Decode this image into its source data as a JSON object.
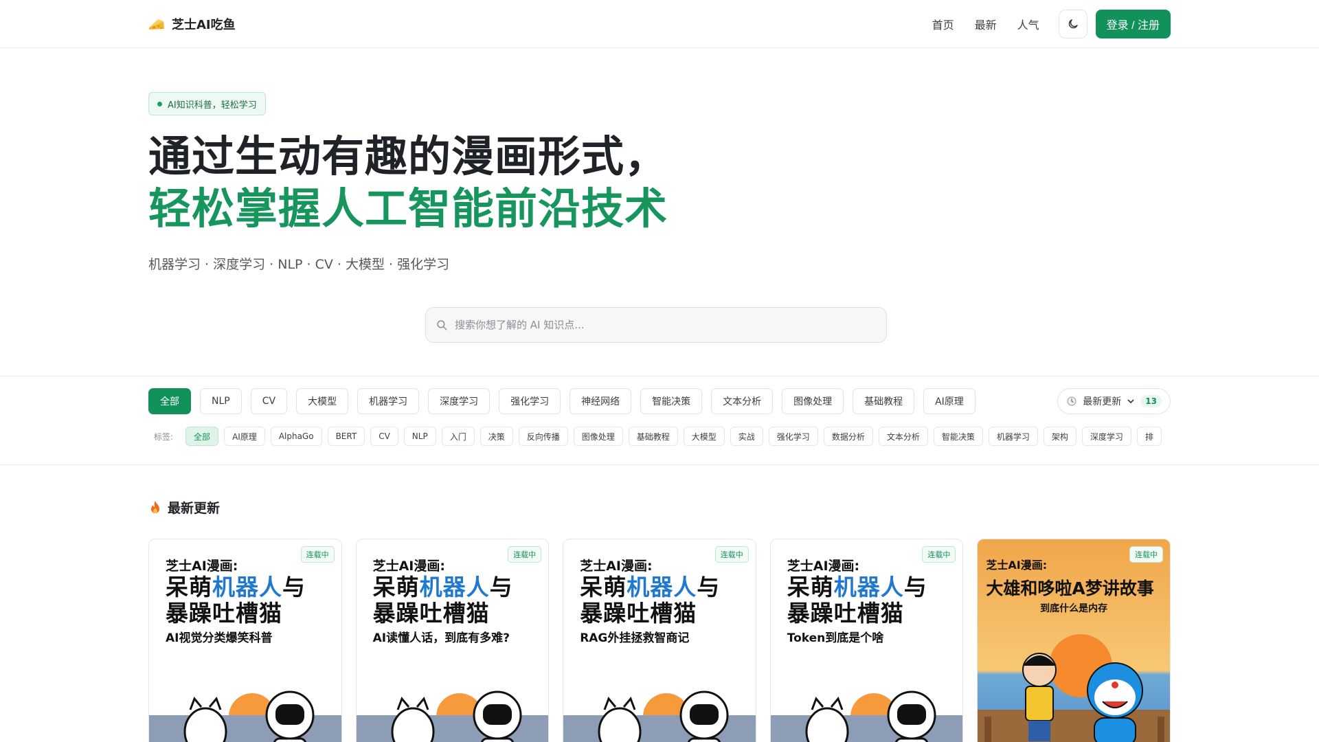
{
  "brand": {
    "name": "芝士AI吃鱼",
    "logo_icon": "cheese-icon"
  },
  "nav": {
    "items": [
      "首页",
      "最新",
      "人气"
    ],
    "login_label": "登录 / 注册"
  },
  "hero": {
    "badge": "AI知识科普，轻松学习",
    "headline_line1": "通过生动有趣的漫画形式，",
    "headline_line2": "轻松掌握人工智能前沿技术",
    "subtitle": "机器学习 · 深度学习 · NLP · CV · 大模型 · 强化学习",
    "search_placeholder": "搜索你想了解的 AI 知识点..."
  },
  "filters": {
    "categories": [
      "全部",
      "NLP",
      "CV",
      "大模型",
      "机器学习",
      "深度学习",
      "强化学习",
      "神经网络",
      "智能决策",
      "文本分析",
      "图像处理",
      "基础教程",
      "AI原理"
    ],
    "active_category": "全部",
    "sort_label": "最新更新",
    "count": "13",
    "tag_label": "标签:",
    "tags": [
      "全部",
      "AI原理",
      "AlphaGo",
      "BERT",
      "CV",
      "NLP",
      "入门",
      "决策",
      "反向传播",
      "图像处理",
      "基础教程",
      "大模型",
      "实战",
      "强化学习",
      "数据分析",
      "文本分析",
      "智能决策",
      "机器学习",
      "架构",
      "深度学习",
      "排"
    ]
  },
  "section": {
    "title": "最新更新",
    "icon": "fire-icon"
  },
  "cards": [
    {
      "status": "连载中",
      "series": "芝士AI漫画:",
      "title_a": "呆萌",
      "title_b": "机器人",
      "title_c": "与",
      "title_d": "暴躁吐槽猫",
      "subtitle": "AI视觉分类爆笑科普"
    },
    {
      "status": "连载中",
      "series": "芝士AI漫画:",
      "title_a": "呆萌",
      "title_b": "机器人",
      "title_c": "与",
      "title_d": "暴躁吐槽猫",
      "subtitle": "AI读懂人话，到底有多难?"
    },
    {
      "status": "连载中",
      "series": "芝士AI漫画:",
      "title_a": "呆萌",
      "title_b": "机器人",
      "title_c": "与",
      "title_d": "暴躁吐槽猫",
      "subtitle": "RAG外挂拯救智商记"
    },
    {
      "status": "连载中",
      "series": "芝士AI漫画:",
      "title_a": "呆萌",
      "title_b": "机器人",
      "title_c": "与",
      "title_d": "暴躁吐槽猫",
      "subtitle": "Token到底是个啥"
    },
    {
      "status": "连载中",
      "series": "芝士AI漫画:",
      "title": "大雄和哆啦A梦讲故事",
      "subtitle": "到底什么是内存"
    }
  ],
  "colors": {
    "accent": "#12925a",
    "headline_green": "#16955d",
    "title_blue": "#1f78d1"
  }
}
